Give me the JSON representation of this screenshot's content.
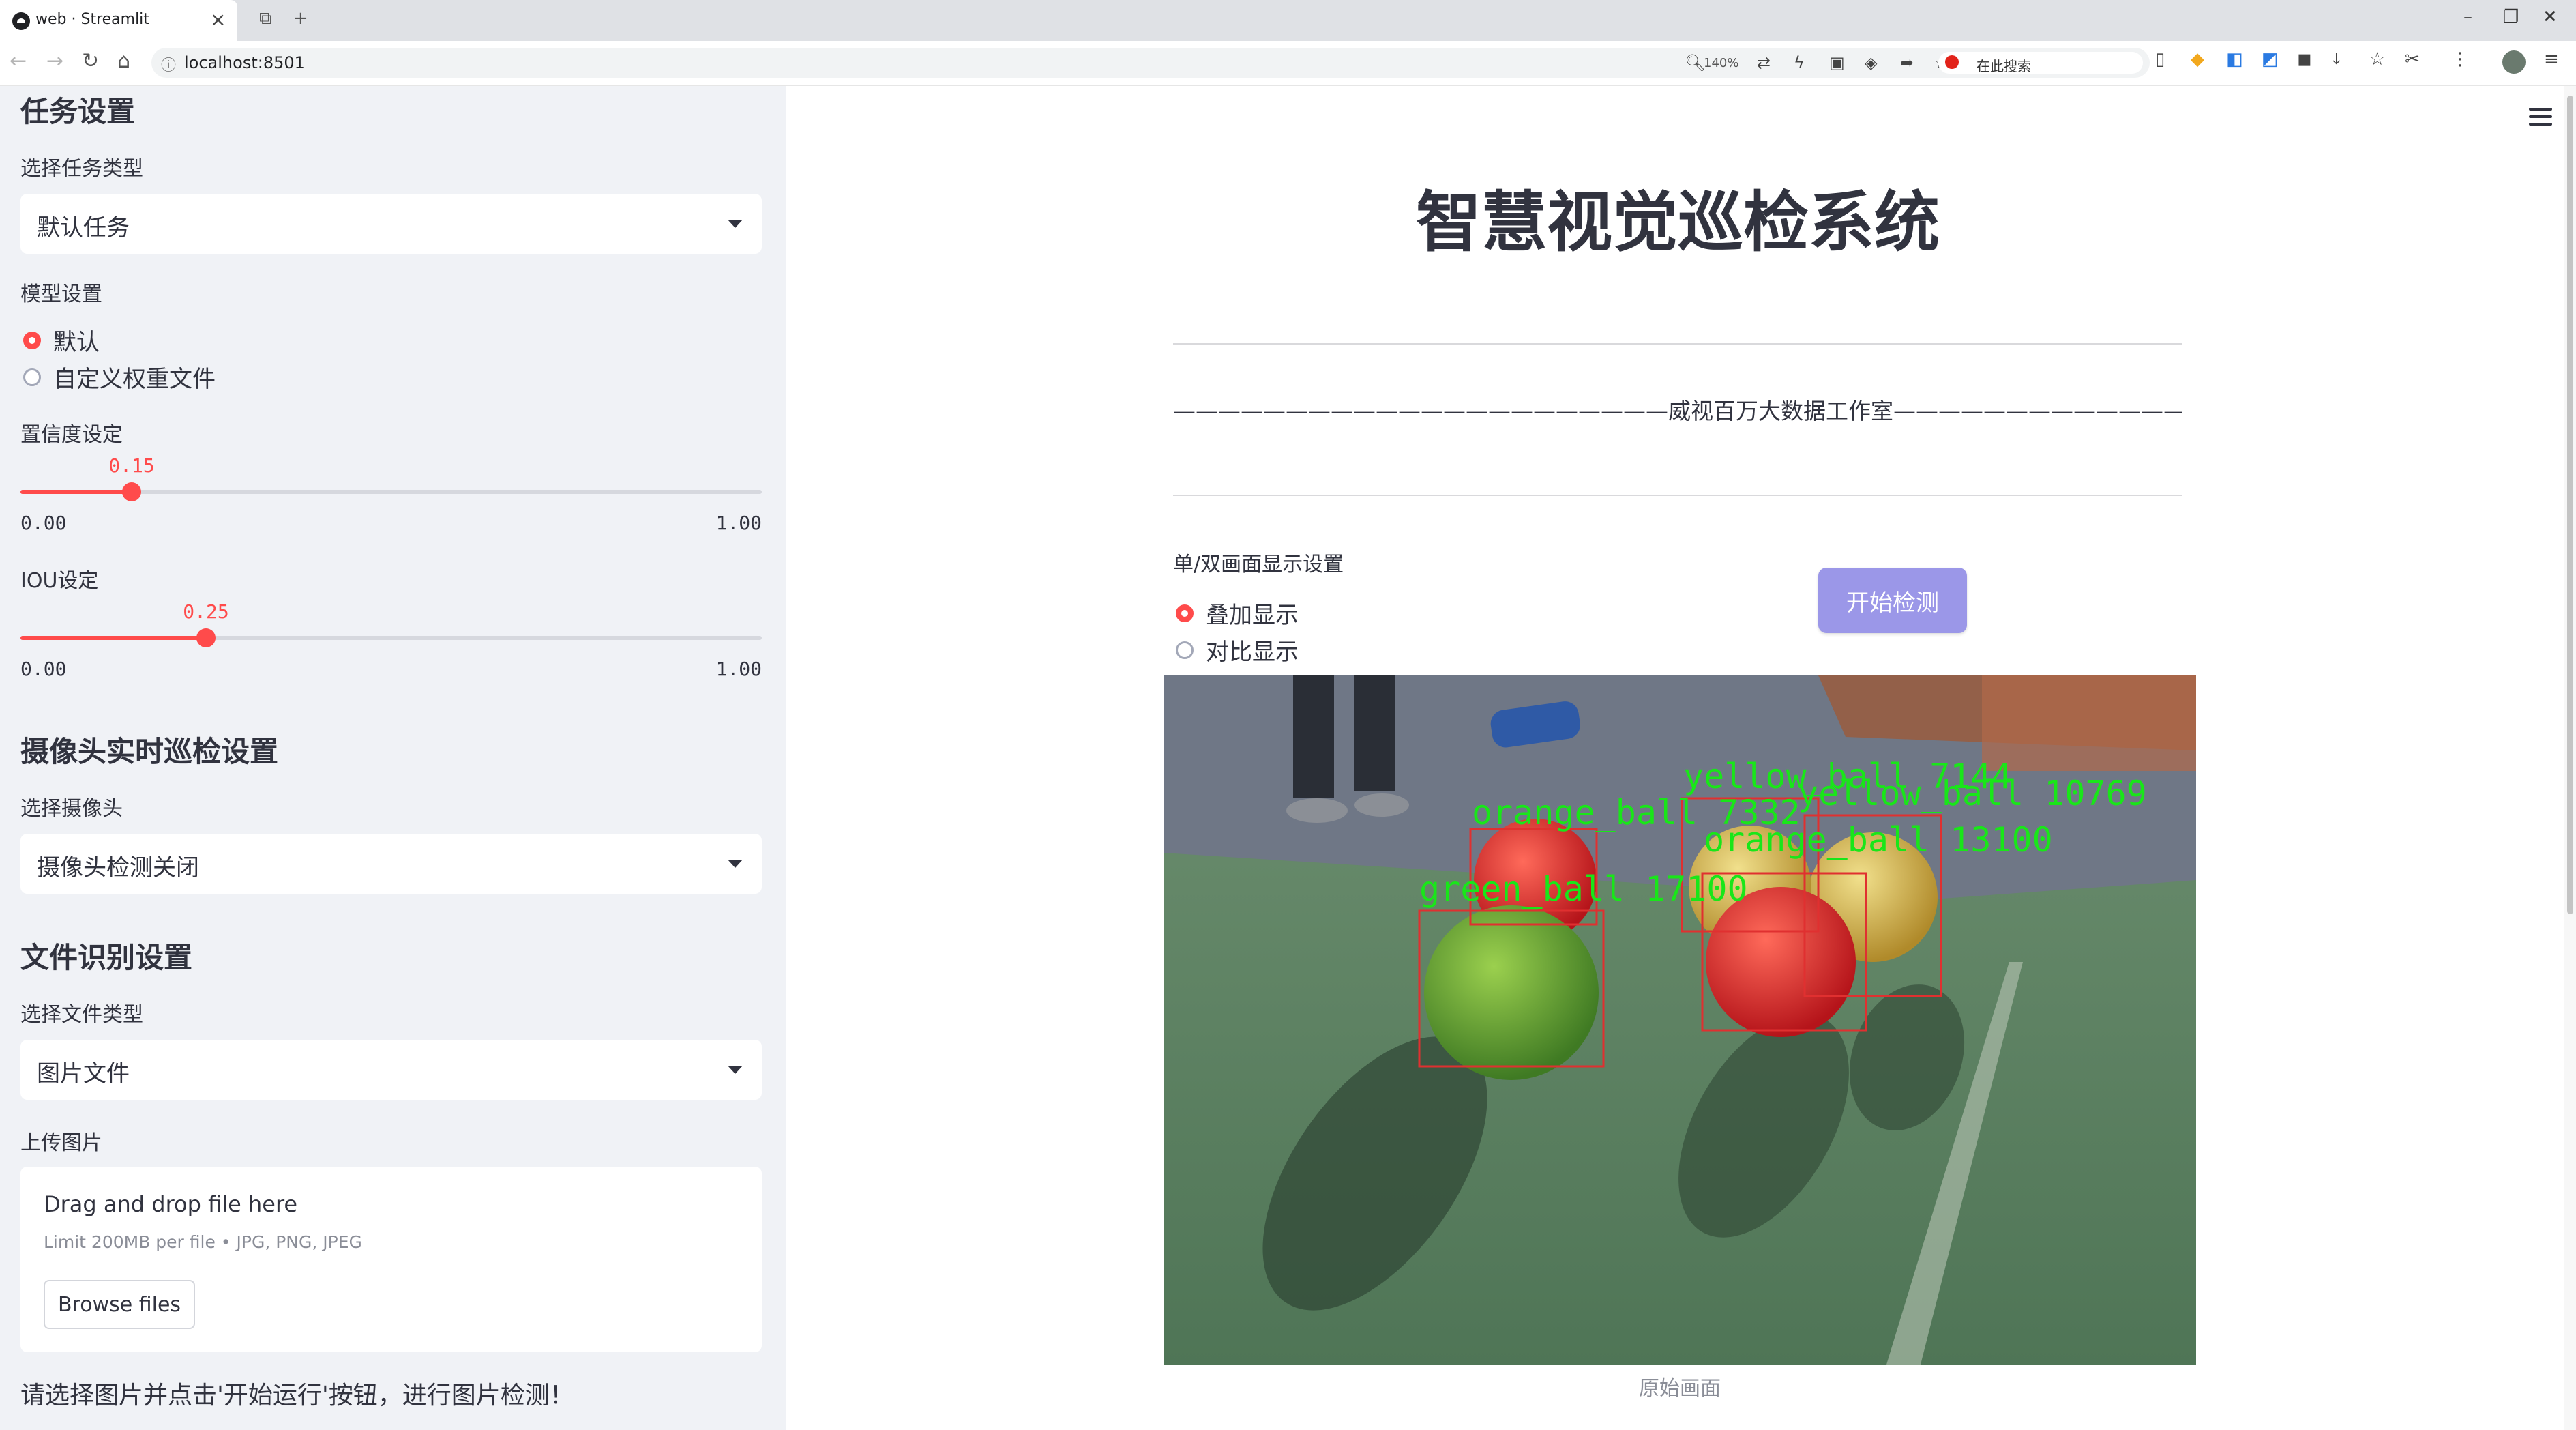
{
  "browser": {
    "tab_title": "web · Streamlit",
    "url": "localhost:8501",
    "zoom": "140%",
    "search_placeholder": "在此搜索"
  },
  "sidebar": {
    "task_section": {
      "title": "任务设置",
      "select_label": "选择任务类型",
      "select_value": "默认任务"
    },
    "model_section": {
      "label": "模型设置",
      "options": [
        "默认",
        "自定义权重文件"
      ],
      "selected": "默认"
    },
    "confidence": {
      "label": "置信度设定",
      "value": 0.15,
      "value_text": "0.15",
      "min": "0.00",
      "max": "1.00"
    },
    "iou": {
      "label": "IOU设定",
      "value": 0.25,
      "value_text": "0.25",
      "min": "0.00",
      "max": "1.00"
    },
    "camera_section": {
      "title": "摄像头实时巡检设置",
      "select_label": "选择摄像头",
      "select_value": "摄像头检测关闭"
    },
    "file_section": {
      "title": "文件识别设置",
      "select_label": "选择文件类型",
      "select_value": "图片文件",
      "upload_label": "上传图片",
      "drop_text": "Drag and drop file here",
      "limit_text": "Limit 200MB per file • JPG, PNG, JPEG",
      "browse_label": "Browse files"
    },
    "hint": "请选择图片并点击'开始运行'按钮，进行图片检测！"
  },
  "main": {
    "title": "智慧视觉巡检系统",
    "studio_line": "——————————————————————威视百万大数据工作室———————————————————————",
    "display_label": "单/双画面显示设置",
    "display_options": [
      "叠加显示",
      "对比显示"
    ],
    "display_selected": "叠加显示",
    "start_button": "开始检测",
    "caption": "原始画面",
    "detections": [
      {
        "label": "orange_ball 7332",
        "color": "#00ff00"
      },
      {
        "label": "green_ball 17100",
        "color": "#00ff00"
      },
      {
        "label": "yellow_ball 7144",
        "color": "#00ff00"
      },
      {
        "label": "yellow_ball 10769",
        "color": "#00ff00"
      },
      {
        "label": "orange_ball 13100",
        "color": "#00ff00"
      }
    ]
  },
  "colors": {
    "accent": "#ff4b4b",
    "button": "#9b97e8",
    "sidebar_bg": "#f0f2f6",
    "box": "#e03030"
  }
}
